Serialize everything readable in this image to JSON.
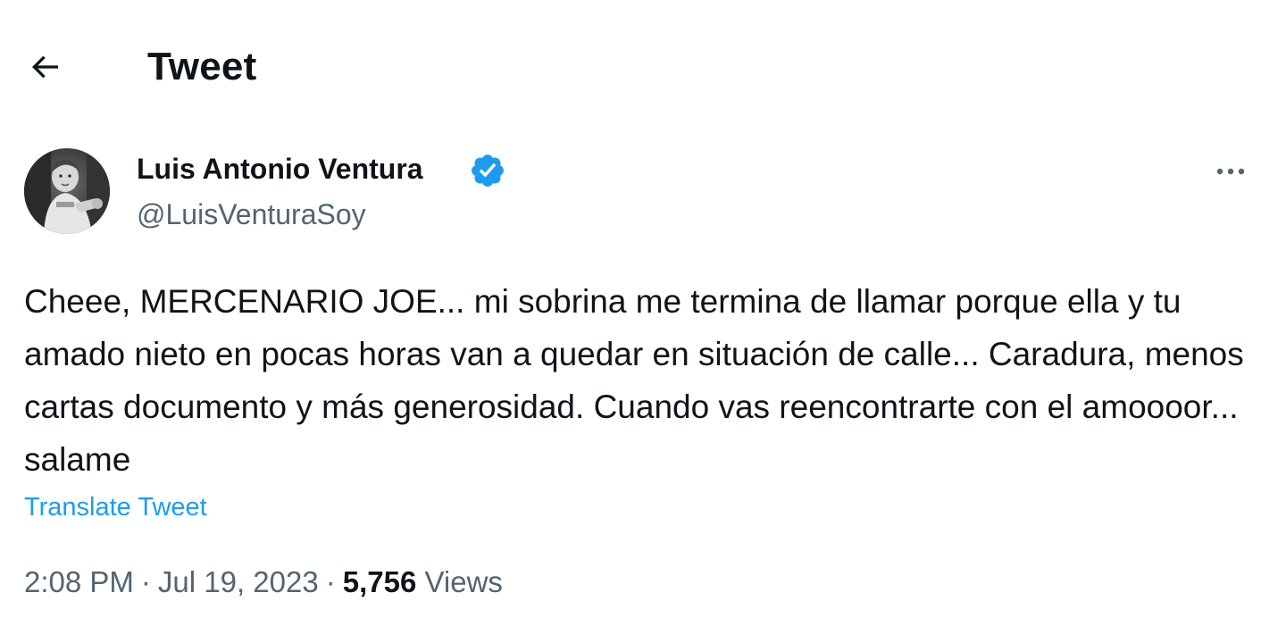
{
  "header": {
    "title": "Tweet",
    "back_icon": "arrow-left-icon"
  },
  "tweet": {
    "author": {
      "name": "Luis Antonio Ventura",
      "handle": "@LuisVenturaSoy",
      "verified": true,
      "verified_icon": "verified-badge-icon",
      "verified_color": "#1d9bf0"
    },
    "more_icon": "more-options-icon",
    "text": "Cheee, MERCENARIO JOE... mi sobrina me termina de llamar porque ella y tu amado nieto en pocas horas van a quedar en situación de calle... Caradura, menos cartas documento y más generosidad. Cuando vas reencontrarte con el amoooor... salame",
    "translate_label": "Translate Tweet",
    "time": "2:08 PM",
    "date": "Jul 19, 2023",
    "views_count": "5,756",
    "views_label": "Views",
    "separator": "·"
  },
  "colors": {
    "text_primary": "#0f1419",
    "text_secondary": "#536471",
    "accent": "#1d9bf0"
  }
}
